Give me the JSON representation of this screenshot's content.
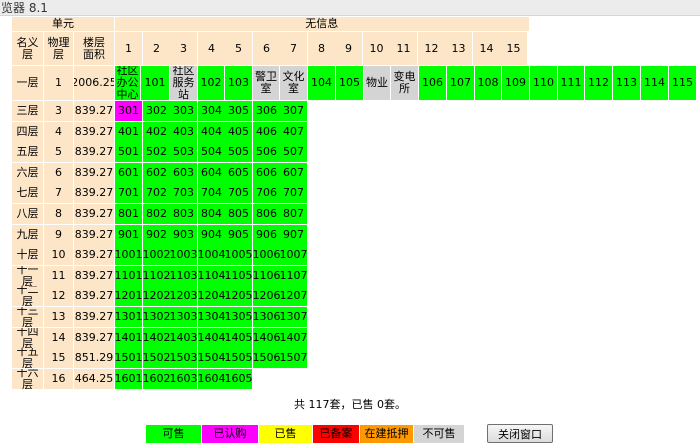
{
  "window": {
    "title": "览器 8.1"
  },
  "header": {
    "unit_label": "单元",
    "info_label": "无信息",
    "col_name": "名义\n层",
    "col_physical": "物理\n层",
    "col_area": "楼层\n面积",
    "unit_numbers": [
      "1",
      "2",
      "3",
      "4",
      "5",
      "6",
      "7",
      "8",
      "9",
      "10",
      "11",
      "12",
      "13",
      "14",
      "15"
    ]
  },
  "floors": [
    {
      "name": "一层",
      "physical": "1",
      "area": "2006.25",
      "rooms": [
        {
          "label": "社区\n办公\n中心",
          "status": "sold"
        },
        {
          "label": "101",
          "status": "available"
        },
        {
          "label": "社区\n服务\n站",
          "status": "unavailable"
        },
        {
          "label": "102",
          "status": "available"
        },
        {
          "label": "103",
          "status": "available"
        },
        {
          "label": "警卫\n室",
          "status": "unavailable"
        },
        {
          "label": "文化\n室",
          "status": "unavailable"
        },
        {
          "label": "104",
          "status": "available"
        },
        {
          "label": "105",
          "status": "available"
        },
        {
          "label": "物业",
          "status": "unavailable"
        },
        {
          "label": "变电\n所",
          "status": "unavailable"
        },
        {
          "label": "106",
          "status": "available"
        },
        {
          "label": "107",
          "status": "available"
        },
        {
          "label": "108",
          "status": "available"
        },
        {
          "label": "109",
          "status": "available"
        },
        {
          "label": "110",
          "status": "available"
        },
        {
          "label": "111",
          "status": "available"
        },
        {
          "label": "112",
          "status": "available"
        },
        {
          "label": "113",
          "status": "available"
        },
        {
          "label": "114",
          "status": "available"
        },
        {
          "label": "115",
          "status": "available"
        }
      ]
    },
    {
      "name": "三层",
      "physical": "3",
      "area": "839.27",
      "rooms": [
        {
          "label": "301",
          "status": "subscribed"
        },
        {
          "label": "302",
          "status": "available"
        },
        {
          "label": "303",
          "status": "available"
        },
        {
          "label": "304",
          "status": "available"
        },
        {
          "label": "305",
          "status": "available"
        },
        {
          "label": "306",
          "status": "available"
        },
        {
          "label": "307",
          "status": "available"
        }
      ]
    },
    {
      "name": "四层",
      "physical": "4",
      "area": "839.27",
      "rooms": [
        {
          "label": "401",
          "status": "available"
        },
        {
          "label": "402",
          "status": "available"
        },
        {
          "label": "403",
          "status": "available"
        },
        {
          "label": "404",
          "status": "available"
        },
        {
          "label": "405",
          "status": "available"
        },
        {
          "label": "406",
          "status": "available"
        },
        {
          "label": "407",
          "status": "available"
        }
      ]
    },
    {
      "name": "五层",
      "physical": "5",
      "area": "839.27",
      "rooms": [
        {
          "label": "501",
          "status": "available"
        },
        {
          "label": "502",
          "status": "available"
        },
        {
          "label": "503",
          "status": "available"
        },
        {
          "label": "504",
          "status": "available"
        },
        {
          "label": "505",
          "status": "available"
        },
        {
          "label": "506",
          "status": "available"
        },
        {
          "label": "507",
          "status": "available"
        }
      ]
    },
    {
      "name": "六层",
      "physical": "6",
      "area": "839.27",
      "rooms": [
        {
          "label": "601",
          "status": "available"
        },
        {
          "label": "602",
          "status": "available"
        },
        {
          "label": "603",
          "status": "available"
        },
        {
          "label": "604",
          "status": "available"
        },
        {
          "label": "605",
          "status": "available"
        },
        {
          "label": "606",
          "status": "available"
        },
        {
          "label": "607",
          "status": "available"
        }
      ]
    },
    {
      "name": "七层",
      "physical": "7",
      "area": "839.27",
      "rooms": [
        {
          "label": "701",
          "status": "available"
        },
        {
          "label": "702",
          "status": "available"
        },
        {
          "label": "703",
          "status": "available"
        },
        {
          "label": "704",
          "status": "available"
        },
        {
          "label": "705",
          "status": "available"
        },
        {
          "label": "706",
          "status": "available"
        },
        {
          "label": "707",
          "status": "available"
        }
      ]
    },
    {
      "name": "八层",
      "physical": "8",
      "area": "839.27",
      "rooms": [
        {
          "label": "801",
          "status": "available"
        },
        {
          "label": "802",
          "status": "available"
        },
        {
          "label": "803",
          "status": "available"
        },
        {
          "label": "804",
          "status": "available"
        },
        {
          "label": "805",
          "status": "available"
        },
        {
          "label": "806",
          "status": "available"
        },
        {
          "label": "807",
          "status": "available"
        }
      ]
    },
    {
      "name": "九层",
      "physical": "9",
      "area": "839.27",
      "rooms": [
        {
          "label": "901",
          "status": "available"
        },
        {
          "label": "902",
          "status": "available"
        },
        {
          "label": "903",
          "status": "available"
        },
        {
          "label": "904",
          "status": "available"
        },
        {
          "label": "905",
          "status": "available"
        },
        {
          "label": "906",
          "status": "available"
        },
        {
          "label": "907",
          "status": "available"
        }
      ]
    },
    {
      "name": "十层",
      "physical": "10",
      "area": "839.27",
      "rooms": [
        {
          "label": "1001",
          "status": "available"
        },
        {
          "label": "1002",
          "status": "available"
        },
        {
          "label": "1003",
          "status": "available"
        },
        {
          "label": "1004",
          "status": "available"
        },
        {
          "label": "1005",
          "status": "available"
        },
        {
          "label": "1006",
          "status": "available"
        },
        {
          "label": "1007",
          "status": "available"
        }
      ]
    },
    {
      "name": "十一层",
      "physical": "11",
      "area": "839.27",
      "rooms": [
        {
          "label": "1101",
          "status": "available"
        },
        {
          "label": "1102",
          "status": "available"
        },
        {
          "label": "1103",
          "status": "available"
        },
        {
          "label": "1104",
          "status": "available"
        },
        {
          "label": "1105",
          "status": "available"
        },
        {
          "label": "1106",
          "status": "available"
        },
        {
          "label": "1107",
          "status": "available"
        }
      ]
    },
    {
      "name": "十二层",
      "physical": "12",
      "area": "839.27",
      "rooms": [
        {
          "label": "1201",
          "status": "available"
        },
        {
          "label": "1202",
          "status": "available"
        },
        {
          "label": "1203",
          "status": "available"
        },
        {
          "label": "1204",
          "status": "available"
        },
        {
          "label": "1205",
          "status": "available"
        },
        {
          "label": "1206",
          "status": "available"
        },
        {
          "label": "1207",
          "status": "available"
        }
      ]
    },
    {
      "name": "十三层",
      "physical": "13",
      "area": "839.27",
      "rooms": [
        {
          "label": "1301",
          "status": "available"
        },
        {
          "label": "1302",
          "status": "available"
        },
        {
          "label": "1303",
          "status": "available"
        },
        {
          "label": "1304",
          "status": "available"
        },
        {
          "label": "1305",
          "status": "available"
        },
        {
          "label": "1306",
          "status": "available"
        },
        {
          "label": "1307",
          "status": "available"
        }
      ]
    },
    {
      "name": "十四层",
      "physical": "14",
      "area": "839.27",
      "rooms": [
        {
          "label": "1401",
          "status": "available"
        },
        {
          "label": "1402",
          "status": "available"
        },
        {
          "label": "1403",
          "status": "available"
        },
        {
          "label": "1404",
          "status": "available"
        },
        {
          "label": "1405",
          "status": "available"
        },
        {
          "label": "1406",
          "status": "available"
        },
        {
          "label": "1407",
          "status": "available"
        }
      ]
    },
    {
      "name": "十五层",
      "physical": "15",
      "area": "851.29",
      "rooms": [
        {
          "label": "1501",
          "status": "available"
        },
        {
          "label": "1502",
          "status": "available"
        },
        {
          "label": "1503",
          "status": "available"
        },
        {
          "label": "1504",
          "status": "available"
        },
        {
          "label": "1505",
          "status": "available"
        },
        {
          "label": "1506",
          "status": "available"
        },
        {
          "label": "1507",
          "status": "available"
        }
      ]
    },
    {
      "name": "十六层",
      "physical": "16",
      "area": "464.25",
      "rooms": [
        {
          "label": "1601",
          "status": "available"
        },
        {
          "label": "1602",
          "status": "available"
        },
        {
          "label": "1603",
          "status": "available"
        },
        {
          "label": "1604",
          "status": "available"
        },
        {
          "label": "1605",
          "status": "available"
        }
      ]
    }
  ],
  "summary": {
    "text": "共 117套，已售 0套。"
  },
  "legend": [
    {
      "label": "可售",
      "key": "available",
      "color": "#00ff00",
      "text_color": "#000000"
    },
    {
      "label": "已认购",
      "key": "subscribed",
      "color": "#ff00ff",
      "text_color": "#000000"
    },
    {
      "label": "已售",
      "key": "sold",
      "color": "#ffff00",
      "text_color": "#000000"
    },
    {
      "label": "已备案",
      "key": "filed",
      "color": "#ff0000",
      "text_color": "#000000"
    },
    {
      "label": "在建抵押",
      "key": "mortgaged",
      "color": "#ff9900",
      "text_color": "#000000"
    },
    {
      "label": "不可售",
      "key": "unavailable",
      "color": "#d4d4d4",
      "text_color": "#000000"
    }
  ],
  "buttons": {
    "close_window": "关闭窗口"
  }
}
